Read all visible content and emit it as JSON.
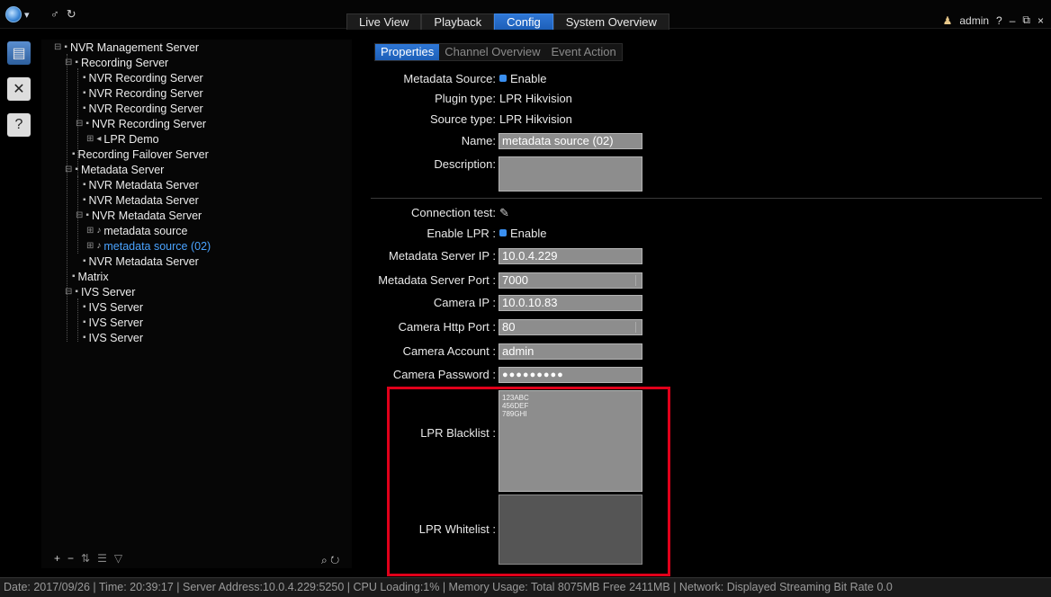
{
  "top": {
    "tabs": [
      {
        "label": "Live View",
        "active": false
      },
      {
        "label": "Playback",
        "active": false
      },
      {
        "label": "Config",
        "active": true
      },
      {
        "label": "System Overview",
        "active": false
      }
    ],
    "user": "admin",
    "help": "?",
    "minimize": "–",
    "restore": "⧉",
    "close": "×"
  },
  "tree": {
    "items": [
      {
        "label": "NVR Management Server"
      },
      {
        "label": "Recording Server"
      },
      {
        "label": "NVR Recording Server"
      },
      {
        "label": "NVR Recording Server"
      },
      {
        "label": "NVR Recording Server"
      },
      {
        "label": "NVR Recording Server"
      },
      {
        "label": "LPR Demo"
      },
      {
        "label": "Recording Failover Server"
      },
      {
        "label": "Metadata Server"
      },
      {
        "label": "NVR Metadata Server"
      },
      {
        "label": "NVR Metadata Server"
      },
      {
        "label": "NVR Metadata Server"
      },
      {
        "label": "metadata source"
      },
      {
        "label": "metadata source (02)"
      },
      {
        "label": "NVR Metadata Server"
      },
      {
        "label": "Matrix"
      },
      {
        "label": "IVS Server"
      },
      {
        "label": "IVS Server"
      },
      {
        "label": "IVS Server"
      },
      {
        "label": "IVS Server"
      }
    ],
    "toolbar": {
      "add": "+",
      "remove": "−",
      "sort": "⇅",
      "list": "☰",
      "filter": "▽"
    }
  },
  "config": {
    "subtabs": [
      {
        "label": "Properties",
        "active": true
      },
      {
        "label": "Channel Overview",
        "active": false
      },
      {
        "label": "Event Action",
        "active": false
      }
    ],
    "metadata_source_label": "Metadata Source:",
    "metadata_source_value": "Enable",
    "plugin_type_label": "Plugin type:",
    "plugin_type_value": "LPR Hikvision",
    "source_type_label": "Source type:",
    "source_type_value": "LPR Hikvision",
    "name_label": "Name:",
    "name_value": "metadata source (02)",
    "description_label": "Description:",
    "connection_test_label": "Connection test:",
    "enable_lpr_label": "Enable LPR :",
    "enable_lpr_value": "Enable",
    "server_ip_label": "Metadata Server IP :",
    "server_ip_value": "10.0.4.229",
    "server_port_label": "Metadata Server Port :",
    "server_port_value": "7000",
    "camera_ip_label": "Camera IP :",
    "camera_ip_value": "10.0.10.83",
    "camera_http_port_label": "Camera Http Port :",
    "camera_http_port_value": "80",
    "camera_account_label": "Camera Account :",
    "camera_account_value": "admin",
    "camera_password_label": "Camera Password :",
    "camera_password_value": "●●●●●●●●●",
    "blacklist_label": "LPR Blacklist :",
    "blacklist_entries": [
      "123ABC",
      "456DEF",
      "789GHI"
    ],
    "whitelist_label": "LPR Whitelist :"
  },
  "status": {
    "text": "Date: 2017/09/26  |  Time: 20:39:17  |  Server Address:10.0.4.229:5250  |  CPU Loading:1%  |  Memory Usage: Total 8075MB  Free 2411MB  |  Network: Displayed Streaming Bit Rate    0.0"
  },
  "colors": {
    "accent": "#2f77d6",
    "highlight": "#e0001a",
    "selected_text": "#4aa3ff"
  }
}
